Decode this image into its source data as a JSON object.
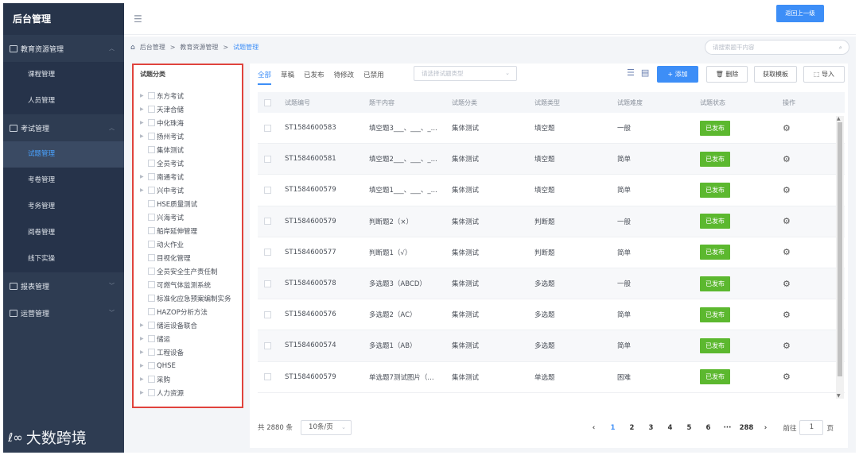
{
  "sidebar": {
    "title": "后台管理",
    "groups": [
      {
        "label": "教育资源管理",
        "items": [
          "课程管理",
          "人员管理"
        ]
      },
      {
        "label": "考试管理",
        "items": [
          "试题管理",
          "考卷管理",
          "考务管理",
          "阅卷管理",
          "线下实操"
        ]
      },
      {
        "label": "报表管理",
        "items": []
      },
      {
        "label": "运营管理",
        "items": []
      }
    ],
    "active_item": "试题管理",
    "watermark": "大数跨境"
  },
  "topbar": {
    "back_button": "返回上一级"
  },
  "breadcrumb": [
    "后台管理",
    "教育资源管理",
    "试题管理"
  ],
  "search": {
    "placeholder": "请搜索题干内容"
  },
  "tree": {
    "title": "试题分类",
    "nodes": [
      {
        "label": "东方考试",
        "expandable": true
      },
      {
        "label": "天津合储",
        "expandable": true
      },
      {
        "label": "中化珠海",
        "expandable": true
      },
      {
        "label": "扬州考试",
        "expandable": true
      },
      {
        "label": "集体测试",
        "expandable": false
      },
      {
        "label": "全员考试",
        "expandable": false
      },
      {
        "label": "南通考试",
        "expandable": true
      },
      {
        "label": "兴中考试",
        "expandable": true
      },
      {
        "label": "HSE质量测试",
        "expandable": false
      },
      {
        "label": "兴海考试",
        "expandable": false
      },
      {
        "label": "船岸延伸管理",
        "expandable": false
      },
      {
        "label": "动火作业",
        "expandable": false
      },
      {
        "label": "目视化管理",
        "expandable": false
      },
      {
        "label": "全员安全生产责任制",
        "expandable": false
      },
      {
        "label": "可燃气体监测系统",
        "expandable": false
      },
      {
        "label": "标准化应急预案编制实务",
        "expandable": false
      },
      {
        "label": "HAZOP分析方法",
        "expandable": false
      },
      {
        "label": "储运设备联合",
        "expandable": true
      },
      {
        "label": "储运",
        "expandable": true
      },
      {
        "label": "工程设备",
        "expandable": true
      },
      {
        "label": "QHSE",
        "expandable": true
      },
      {
        "label": "采购",
        "expandable": true
      },
      {
        "label": "人力资源",
        "expandable": true
      }
    ]
  },
  "tabs": [
    "全部",
    "草稿",
    "已发布",
    "待修改",
    "已禁用"
  ],
  "type_select": {
    "placeholder": "请选择试题类型"
  },
  "toolbar": {
    "add": "+ 添加",
    "delete": "删除",
    "template": "获取模板",
    "import": "导入"
  },
  "table": {
    "headers": [
      "试题编号",
      "题干内容",
      "试题分类",
      "试题类型",
      "试题难度",
      "试题状态",
      "操作"
    ],
    "rows": [
      [
        "ST1584600583",
        "填空题3___、___、_...",
        "集体测试",
        "填空题",
        "一般",
        "已发布"
      ],
      [
        "ST1584600581",
        "填空题2___、___、_...",
        "集体测试",
        "填空题",
        "简单",
        "已发布"
      ],
      [
        "ST1584600579",
        "填空题1___、___、_...",
        "集体测试",
        "填空题",
        "简单",
        "已发布"
      ],
      [
        "ST1584600579",
        "判断题2（×）",
        "集体测试",
        "判断题",
        "一般",
        "已发布"
      ],
      [
        "ST1584600577",
        "判断题1（√）",
        "集体测试",
        "判断题",
        "简单",
        "已发布"
      ],
      [
        "ST1584600578",
        "多选题3（ABCD）",
        "集体测试",
        "多选题",
        "一般",
        "已发布"
      ],
      [
        "ST1584600576",
        "多选题2（AC）",
        "集体测试",
        "多选题",
        "简单",
        "已发布"
      ],
      [
        "ST1584600574",
        "多选题1（AB）",
        "集体测试",
        "多选题",
        "简单",
        "已发布"
      ],
      [
        "ST1584600579",
        "单选题7测试图片（...",
        "集体测试",
        "单选题",
        "困难",
        "已发布"
      ]
    ]
  },
  "footer": {
    "total": "共 2880 条",
    "page_size": "10条/页",
    "pages": [
      "1",
      "2",
      "3",
      "4",
      "5",
      "6",
      "···",
      "288"
    ],
    "current_page": "1",
    "goto_label": "前往",
    "goto_value": "1",
    "page_unit": "页"
  },
  "colors": {
    "sidebar_bg": "#2e3c52",
    "accent": "#3d8ef7",
    "status_green": "#5cb82f",
    "highlight_border": "#e0433d"
  }
}
